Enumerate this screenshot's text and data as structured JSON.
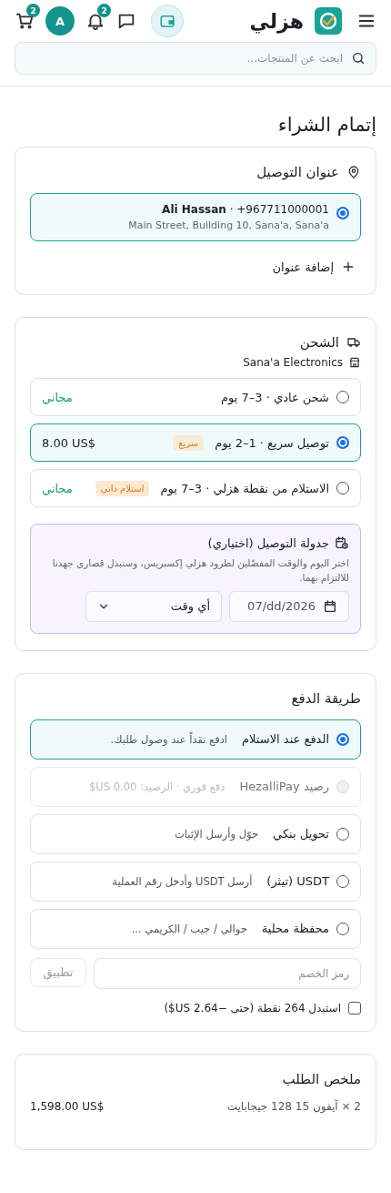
{
  "header": {
    "brand": "هزلي",
    "notifications_badge": "2",
    "avatar_initial": "A",
    "cart_badge": "2"
  },
  "search": {
    "placeholder": "ابحث عن المنتجات..."
  },
  "page_title": "إتمام الشراء",
  "address": {
    "title": "عنوان التوصيل",
    "addresses": [
      {
        "contact": "**Ali Hassan** · +967711000001",
        "line": "Main Street, Building 10, Sana'a, Sana'a",
        "selected": true
      }
    ],
    "add_label": "إضافة عنوان"
  },
  "shipping": {
    "title": "الشحن",
    "store": "Sana'a Electronics",
    "options": [
      {
        "label": "شحن عادي · 3–7 يوم",
        "price": "مجاني",
        "free": true,
        "selected": false
      },
      {
        "label": "توصيل سريع · 1–2 يوم",
        "tag": "سريع",
        "price": "8.00 US$",
        "free": false,
        "selected": true
      },
      {
        "label": "الاستلام من نقطة هزلي · 3–7 يوم",
        "tag": "استلام ذاتي",
        "price": "مجاني",
        "free": true,
        "selected": false
      }
    ],
    "schedule": {
      "title": "جدولة التوصيل (اختياري)",
      "note": "اختر اليوم والوقت المفضّلين لطرود هزلي إكسبريس، وسنبذل قصارى جهدنا للالتزام بهما.",
      "date_value": "07/dd/2026",
      "time_value": "أي وقت"
    }
  },
  "payment": {
    "title": "طريقة الدفع",
    "methods": [
      {
        "label": "الدفع عند الاستلام",
        "note": "ادفع نقداً عند وصول طلبك.",
        "selected": true,
        "disabled": false
      },
      {
        "label": "رصيد HezalliPay",
        "note": "دفع فوري · الرصيد: 0.00 US$",
        "selected": false,
        "disabled": true
      },
      {
        "label": "تحويل بنكي",
        "note": "حوّل وأرسل الإثبات",
        "selected": false,
        "disabled": false
      },
      {
        "label": "USDT (تيثر)",
        "note": "أرسل USDT وأدخل رقم العملية",
        "selected": false,
        "disabled": false
      },
      {
        "label": "محفظة محلية",
        "note": "جوالي / جيب / الكريمي ...",
        "selected": false,
        "disabled": false
      }
    ],
    "coupon": {
      "placeholder": "رمز الخصم",
      "apply_label": "تطبيق",
      "apply_disabled": true
    },
    "points": {
      "label": "استبدل 264 نقطة (حتى −2.64 US$)",
      "checked": false
    }
  },
  "summary": {
    "title": "ملخص الطلب",
    "items": [
      {
        "label": "2 × آيفون 15 128 جيجابايت",
        "price": "1,598.00 US$"
      }
    ]
  }
}
